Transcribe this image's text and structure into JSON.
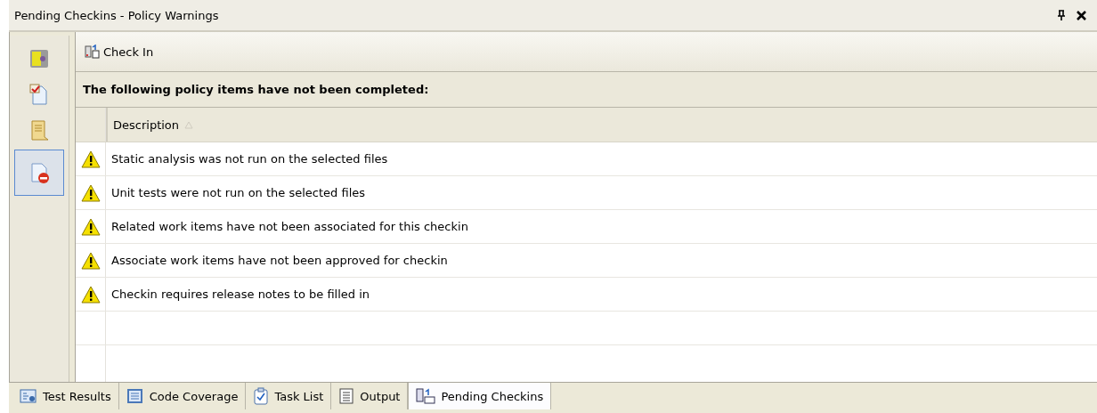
{
  "window": {
    "title": "Pending Checkins - Policy Warnings"
  },
  "sidebar": {
    "items": [
      {
        "selected": false
      },
      {
        "selected": false
      },
      {
        "selected": false
      },
      {
        "selected": true
      }
    ]
  },
  "toolbar": {
    "button": "Check In"
  },
  "message": "The following policy items have not been completed:",
  "table": {
    "columns": [
      "Description"
    ],
    "rows": [
      {
        "kind": "warning",
        "text": "Static analysis was not run on the selected files"
      },
      {
        "kind": "warning",
        "text": "Unit tests were not run on the selected files"
      },
      {
        "kind": "warning",
        "text": "Related work items have not been associated for this checkin"
      },
      {
        "kind": "warning",
        "text": "Associate work items have not been approved for checkin"
      },
      {
        "kind": "warning",
        "text": "Checkin requires release notes to be filled in"
      }
    ]
  },
  "tabs": [
    {
      "label": "Test Results",
      "selected": false
    },
    {
      "label": "Code Coverage",
      "selected": false
    },
    {
      "label": "Task List",
      "selected": false
    },
    {
      "label": "Output",
      "selected": false
    },
    {
      "label": "Pending Checkins",
      "selected": true
    }
  ]
}
